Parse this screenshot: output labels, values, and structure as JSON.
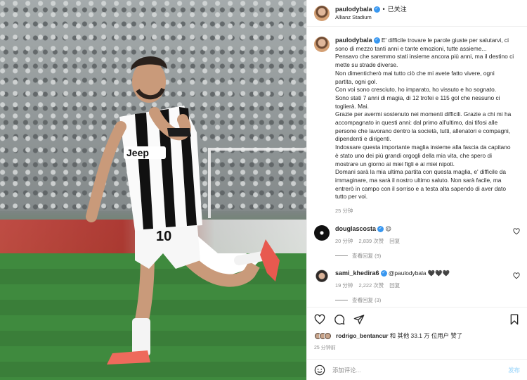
{
  "header": {
    "username": "paulodybala",
    "follow_state": "已关注",
    "separator": "•",
    "location": "Allianz Stadium"
  },
  "photo": {
    "jersey_number": "10",
    "sponsor": "Jeep"
  },
  "caption": {
    "username": "paulodybala",
    "lines": [
      "E' difficile trovare le parole giuste per salutarvi, ci",
      "sono di mezzo tanti anni e tante emozioni, tutte assieme...",
      "Pensavo che saremmo stati insieme ancora più anni, ma il destino ci",
      "mette su strade diverse.",
      "Non dimenticherò mai tutto ciò che mi avete fatto vivere, ogni",
      "partita, ogni gol.",
      "Con voi sono cresciuto, ho imparato, ho vissuto e ho sognato.",
      "Sono stati 7 anni di magia, di 12 trofei e 115 gol che nessuno ci",
      "toglierà. Mai.",
      "Grazie per avermi sostenuto nei momenti difficili. Grazie a chi mi ha",
      "accompagnato in questi anni: dal primo all'ultimo, dai tifosi alle",
      "persone che lavorano dentro la società, tutti, allenatori e compagni,",
      "dipendenti e dirigenti.",
      "Indossare questa importante maglia insieme alla fascia da capitano",
      "è stato uno dei più grandi orgogli della mia vita, che spero di",
      "mostrare un giorno ai miei figli e ai miei nipoti.",
      "Domani sarà la mia ultima partita con questa maglia, e' difficile da",
      "immaginare, ma sarà il nostro ultimo saluto. Non sarà facile, ma",
      "entrerò in campo con il sorriso e a testa alta sapendo di aver dato",
      "tutto per voi."
    ],
    "time": "25 分钟"
  },
  "comments": [
    {
      "username": "douglascosta",
      "text": "😌",
      "time": "20 分钟",
      "likes": "2,839 次赞",
      "reply": "回复",
      "view_replies": "查看回复 (9)"
    },
    {
      "username": "sami_khedira6",
      "text": "@paulodybala 🖤🖤🖤",
      "time": "19 分钟",
      "likes": "2,222 次赞",
      "reply": "回复",
      "view_replies": "查看回复 (3)"
    }
  ],
  "actions": {
    "liked_by_user": "rodrigo_bentancur",
    "liked_by_rest": "和 其他 33.1 万 位用户 赞了",
    "posted_ago": "25 分钟前"
  },
  "composer": {
    "placeholder": "添加评论...",
    "post_label": "发布"
  },
  "colors": {
    "verified": "#3897f0",
    "muted": "#8e8e8e",
    "post_button": "#b2dffc"
  }
}
